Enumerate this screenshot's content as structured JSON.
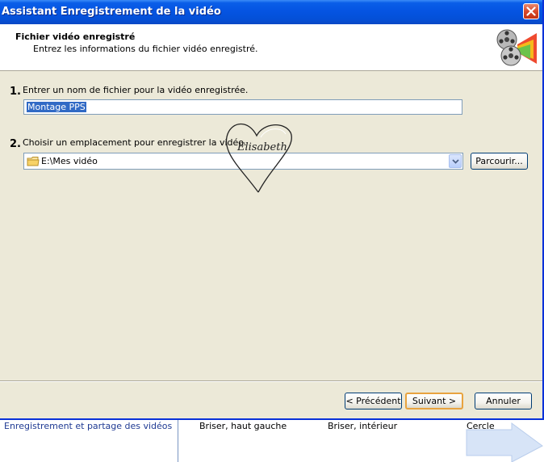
{
  "window": {
    "title": "Assistant Enregistrement de la vidéo"
  },
  "header": {
    "title": "Fichier vidéo enregistré",
    "subtitle": "Entrez les informations du fichier vidéo enregistré.",
    "icon": "film-reel-icon"
  },
  "step1": {
    "number": "1.",
    "label": "Entrer un nom de fichier pour la vidéo enregistrée.",
    "value": "Montage PPS"
  },
  "step2": {
    "number": "2.",
    "label": "Choisir un emplacement pour enregistrer la vidéo.",
    "value": "E:\\Mes vidéo",
    "browse_label": "Parcourir..."
  },
  "watermark": {
    "text": "Elisabeth"
  },
  "footer": {
    "back_label": "< Précédent",
    "next_label": "Suivant >",
    "cancel_label": "Annuler"
  },
  "background": {
    "items": [
      "Enregistrement et partage des vidéos",
      "Briser, haut gauche",
      "Briser, intérieur",
      "Cercle"
    ]
  },
  "colors": {
    "titlebar": "#0554e2",
    "dialog_bg": "#ece9d8",
    "selection": "#316ac5",
    "default_button_border": "#e8a33f",
    "link_text": "#1f3a93"
  }
}
